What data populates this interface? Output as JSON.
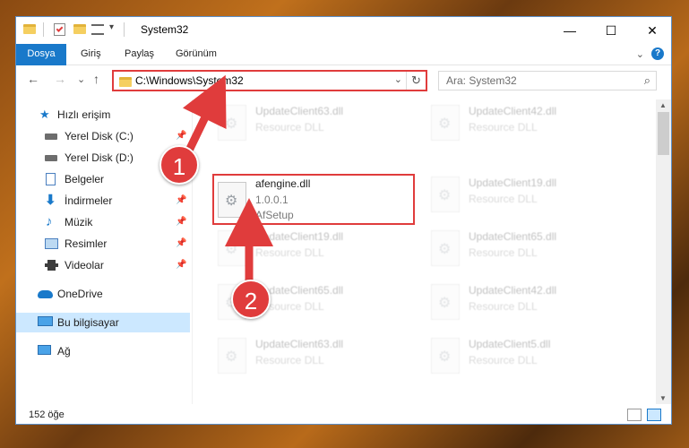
{
  "window": {
    "title": "System32",
    "minimize_symbol": "—",
    "maximize_symbol": "☐",
    "close_symbol": "✕"
  },
  "ribbon": {
    "tabs": [
      "Dosya",
      "Giriş",
      "Paylaş",
      "Görünüm"
    ],
    "expand_symbol": "⌄",
    "help_symbol": "?"
  },
  "nav": {
    "back": "←",
    "forward": "→",
    "recent": "⌄",
    "up": "↑",
    "address": "C:\\Windows\\System32",
    "address_dropdown": "⌄",
    "refresh": "↻",
    "search_placeholder": "Ara: System32",
    "search_icon_glyph": "⌕"
  },
  "sidebar": {
    "pin_glyph": "📌",
    "items": [
      {
        "label": "Hızlı erişim",
        "icon": "star-icon"
      },
      {
        "label": "Yerel Disk (C:)",
        "icon": "drive-icon",
        "pinned": true
      },
      {
        "label": "Yerel Disk (D:)",
        "icon": "drive-icon",
        "pinned": true
      },
      {
        "label": "Belgeler",
        "icon": "document-icon",
        "pinned": true
      },
      {
        "label": "İndirmeler",
        "icon": "download-icon",
        "pinned": true
      },
      {
        "label": "Müzik",
        "icon": "music-icon",
        "pinned": true
      },
      {
        "label": "Resimler",
        "icon": "pictures-icon",
        "pinned": true
      },
      {
        "label": "Videolar",
        "icon": "video-icon",
        "pinned": true
      },
      {
        "label": "OneDrive",
        "icon": "cloud-icon"
      },
      {
        "label": "Bu bilgisayar",
        "icon": "computer-icon",
        "selected": true
      },
      {
        "label": "Ağ",
        "icon": "network-icon"
      }
    ]
  },
  "files": {
    "left": [
      {
        "name": "UpdateClient63.dll",
        "type": "Resource DLL",
        "blurred": true
      },
      {
        "name": "afengine.dll",
        "version": "1.0.0.1",
        "type": "AfSetup",
        "blurred": false
      },
      {
        "name": "UpdateClient19.dll",
        "type": "Resource DLL",
        "blurred": true
      },
      {
        "name": "UpdateClient65.dll",
        "type": "Resource DLL",
        "blurred": true
      },
      {
        "name": "UpdateClient63.dll",
        "type": "Resource DLL",
        "blurred": true
      }
    ],
    "right": [
      {
        "name": "UpdateClient42.dll",
        "type": "Resource DLL",
        "blurred": true
      },
      {
        "name": "UpdateClient19.dll",
        "type": "Resource DLL",
        "blurred": true
      },
      {
        "name": "UpdateClient65.dll",
        "type": "Resource DLL",
        "blurred": true
      },
      {
        "name": "UpdateClient42.dll",
        "type": "Resource DLL",
        "blurred": true
      },
      {
        "name": "UpdateClient5.dll",
        "type": "Resource DLL",
        "blurred": true
      }
    ]
  },
  "status": {
    "item_count": "152 öğe"
  },
  "annotations": {
    "step1": "1",
    "step2": "2",
    "color": "#e03c3c"
  }
}
